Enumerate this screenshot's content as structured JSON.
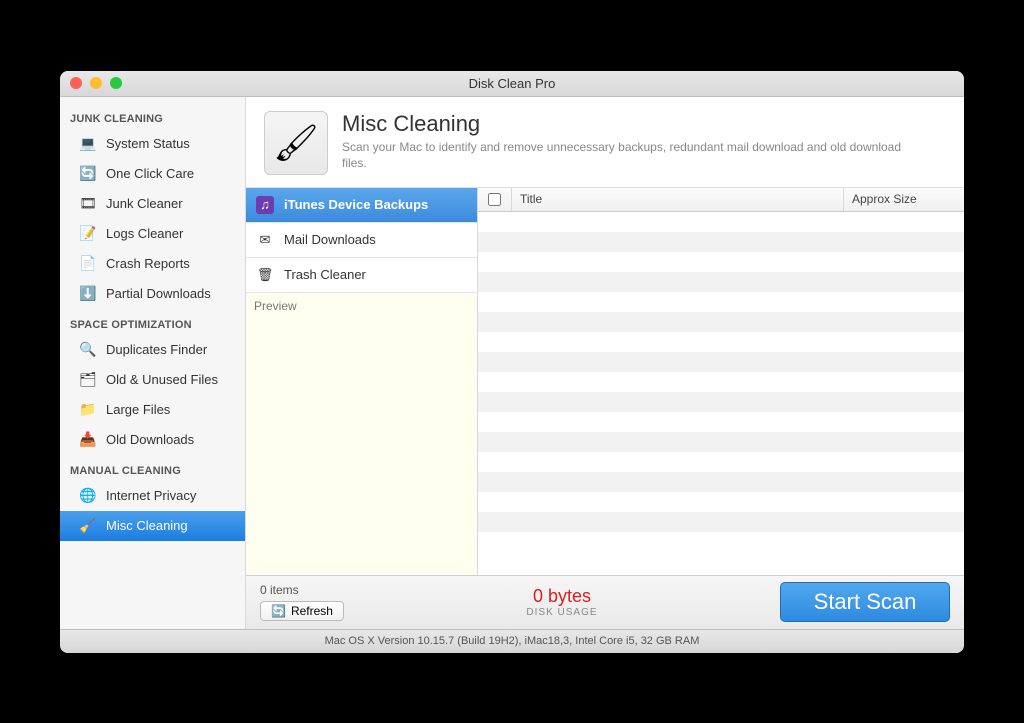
{
  "window": {
    "title": "Disk Clean Pro"
  },
  "sidebar": {
    "sections": [
      {
        "header": "JUNK CLEANING",
        "items": [
          {
            "label": "System Status",
            "icon": "💻",
            "selected": false
          },
          {
            "label": "One Click Care",
            "icon": "🔄",
            "selected": false
          },
          {
            "label": "Junk Cleaner",
            "icon": "🎞",
            "selected": false
          },
          {
            "label": "Logs Cleaner",
            "icon": "📝",
            "selected": false
          },
          {
            "label": "Crash Reports",
            "icon": "📄",
            "selected": false
          },
          {
            "label": "Partial Downloads",
            "icon": "⬇️",
            "selected": false
          }
        ]
      },
      {
        "header": "SPACE OPTIMIZATION",
        "items": [
          {
            "label": "Duplicates Finder",
            "icon": "🔍",
            "selected": false
          },
          {
            "label": "Old & Unused Files",
            "icon": "🗂",
            "selected": false
          },
          {
            "label": "Large Files",
            "icon": "📁",
            "selected": false
          },
          {
            "label": "Old Downloads",
            "icon": "📥",
            "selected": false
          }
        ]
      },
      {
        "header": "MANUAL CLEANING",
        "items": [
          {
            "label": "Internet Privacy",
            "icon": "🌐",
            "selected": false
          },
          {
            "label": "Misc Cleaning",
            "icon": "🧹",
            "selected": true
          }
        ]
      }
    ]
  },
  "header": {
    "title": "Misc Cleaning",
    "description": "Scan your Mac to identify and remove unnecessary backups, redundant mail download and old download files."
  },
  "categories": [
    {
      "label": "iTunes Device Backups",
      "icon": "♫",
      "selected": true
    },
    {
      "label": "Mail Downloads",
      "icon": "✉",
      "selected": false
    },
    {
      "label": "Trash Cleaner",
      "icon": "🗑",
      "selected": false
    }
  ],
  "preview": {
    "label": "Preview"
  },
  "results": {
    "columns": {
      "title": "Title",
      "size": "Approx Size"
    }
  },
  "bottom": {
    "items_count": "0 items",
    "refresh": "Refresh",
    "usage_bytes": "0 bytes",
    "usage_label": "DISK USAGE",
    "scan_button": "Start Scan"
  },
  "statusbar": {
    "text": "Mac OS X Version 10.15.7 (Build 19H2), iMac18,3, Intel Core i5, 32 GB RAM"
  }
}
